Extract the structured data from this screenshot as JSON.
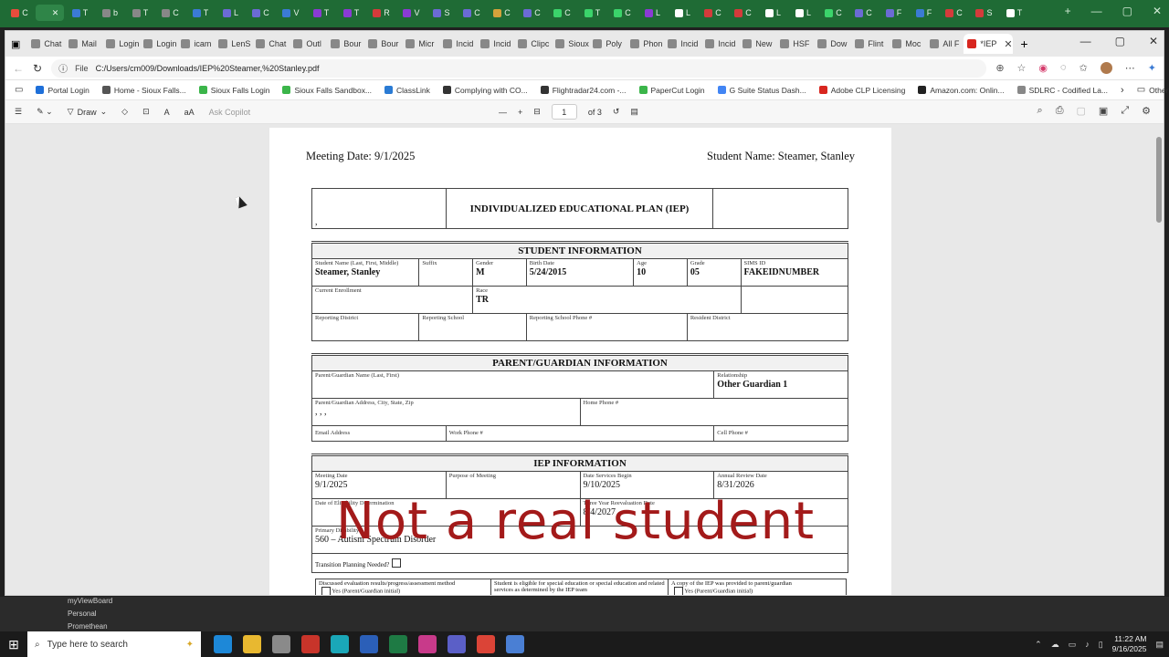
{
  "pinned_tabs": [
    {
      "label": "C",
      "color": "#e74c3c"
    },
    {
      "label": "✕",
      "color": "#2f8548"
    },
    {
      "label": "T",
      "color": "#3b7bd4"
    },
    {
      "label": "b",
      "color": "#888888"
    },
    {
      "label": "T",
      "color": "#888888"
    },
    {
      "label": "C",
      "color": "#888888"
    },
    {
      "label": "T",
      "color": "#3b7bd4"
    },
    {
      "label": "L",
      "color": "#6b6bd4"
    },
    {
      "label": "C",
      "color": "#6b6bd4"
    },
    {
      "label": "V",
      "color": "#3b7bd4"
    },
    {
      "label": "T",
      "color": "#8a3bd4"
    },
    {
      "label": "T",
      "color": "#8a3bd4"
    },
    {
      "label": "R",
      "color": "#d43b3b"
    },
    {
      "label": "V",
      "color": "#8a3bd4"
    },
    {
      "label": "S",
      "color": "#6b6bd4"
    },
    {
      "label": "C",
      "color": "#6b6bd4"
    },
    {
      "label": "C",
      "color": "#d4a23b"
    },
    {
      "label": "C",
      "color": "#6b6bd4"
    },
    {
      "label": "C",
      "color": "#3bd46b"
    },
    {
      "label": "T",
      "color": "#3bd46b"
    },
    {
      "label": "C",
      "color": "#3bd46b"
    },
    {
      "label": "L",
      "color": "#8a3bd4"
    },
    {
      "label": "L",
      "color": "#ffffff"
    },
    {
      "label": "C",
      "color": "#d43b3b"
    },
    {
      "label": "C",
      "color": "#d43b3b"
    },
    {
      "label": "L",
      "color": "#ffffff"
    },
    {
      "label": "L",
      "color": "#ffffff"
    },
    {
      "label": "C",
      "color": "#3bd46b"
    },
    {
      "label": "C",
      "color": "#6b6bd4"
    },
    {
      "label": "F",
      "color": "#6b6bd4"
    },
    {
      "label": "F",
      "color": "#3b7bd4"
    },
    {
      "label": "C",
      "color": "#d43b3b"
    },
    {
      "label": "S",
      "color": "#d43b3b"
    },
    {
      "label": "T",
      "color": "#ffffff"
    }
  ],
  "window_tabs": [
    {
      "label": "Chat"
    },
    {
      "label": "Mail"
    },
    {
      "label": "Login"
    },
    {
      "label": "Login"
    },
    {
      "label": "icam"
    },
    {
      "label": "LenS"
    },
    {
      "label": "Chat"
    },
    {
      "label": "Outl"
    },
    {
      "label": "Bour"
    },
    {
      "label": "Bour"
    },
    {
      "label": "Micr"
    },
    {
      "label": "Incid"
    },
    {
      "label": "Incid"
    },
    {
      "label": "Clipc"
    },
    {
      "label": "Sioux"
    },
    {
      "label": "Poly"
    },
    {
      "label": "Phon"
    },
    {
      "label": "Incid"
    },
    {
      "label": "Incid"
    },
    {
      "label": "New"
    },
    {
      "label": "HSF"
    },
    {
      "label": "Dow"
    },
    {
      "label": "Flint"
    },
    {
      "label": "Moc"
    },
    {
      "label": "All F"
    },
    {
      "label": "*IEP"
    }
  ],
  "window_controls": {
    "minimize": "—",
    "maximize": "▢",
    "close": "✕"
  },
  "address": {
    "file_tag": "File",
    "url": "C:/Users/cm009/Downloads/IEP%20Steamer,%20Stanley.pdf"
  },
  "favorites": [
    {
      "label": "Portal Login",
      "color": "#1e6fd9"
    },
    {
      "label": "Home - Sioux Falls...",
      "color": "#555555"
    },
    {
      "label": "Sioux Falls Login",
      "color": "#3bb54a"
    },
    {
      "label": "Sioux Falls Sandbox...",
      "color": "#3bb54a"
    },
    {
      "label": "ClassLink",
      "color": "#2a7bd4"
    },
    {
      "label": "Complying with CO...",
      "color": "#333333"
    },
    {
      "label": "Flightradar24.com -...",
      "color": "#333333"
    },
    {
      "label": "PaperCut Login",
      "color": "#3bb54a"
    },
    {
      "label": "G Suite Status Dash...",
      "color": "#4285f4"
    },
    {
      "label": "Adobe CLP Licensing",
      "color": "#d8261f"
    },
    {
      "label": "Amazon.com: Onlin...",
      "color": "#222222"
    },
    {
      "label": "SDLRC - Codified La...",
      "color": "#888888"
    }
  ],
  "other_favorites": "Other favorites",
  "pdf_toolbar": {
    "draw": "Draw",
    "copilot": "Ask Copilot",
    "page": "1",
    "of": "of 3"
  },
  "doc": {
    "meeting_date": "Meeting Date: 9/1/2025",
    "student_name": "Student Name: Steamer, Stanley",
    "title": "INDIVIDUALIZED EDUCATIONAL PLAN (IEP)",
    "title_left": ",",
    "student_info": {
      "heading": "STUDENT INFORMATION",
      "name_label": "Student Name (Last, First, Middle)",
      "name": "Steamer, Stanley",
      "suffix_label": "Suffix",
      "gender_label": "Gender",
      "gender": "M",
      "birth_label": "Birth Date",
      "birth": "5/24/2015",
      "age_label": "Age",
      "age": "10",
      "grade_label": "Grade",
      "grade": "05",
      "sims_label": "SIMS ID",
      "sims": "FAKEIDNUMBER",
      "enroll_label": "Current Enrollment",
      "race_label": "Race",
      "race": "TR",
      "district_label": "Reporting District",
      "school_label": "Reporting School",
      "phone_label": "Reporting School Phone #",
      "resident_label": "Resident District"
    },
    "guardian": {
      "heading": "PARENT/GUARDIAN INFORMATION",
      "name_label": "Parent/Guardian Name (Last, First)",
      "rel_label": "Relationship",
      "relationship": "Other Guardian 1",
      "addr_label": "Parent/Guardian Address, City, State, Zip",
      "address": ", , ,",
      "home_label": "Home Phone #",
      "email_label": "Email Address",
      "work_label": "Work Phone #",
      "cell_label": "Cell Phone #"
    },
    "iep": {
      "heading": "IEP INFORMATION",
      "meeting_label": "Meeting Date",
      "meeting": "9/1/2025",
      "purpose_label": "Purpose of Meeting",
      "begin_label": "Date Services Begin",
      "begin": "9/10/2025",
      "review_label": "Annual Review Date",
      "review": "8/31/2026",
      "elig_label": "Date of Eligibility Determination",
      "reeval_label": "Three Year Reevaluation Date",
      "reeval": "8/4/2027",
      "primary_label": "Primary Disability",
      "primary": "560 – Autism Spectrum Disorder",
      "transition_label": "Transition Planning Needed?",
      "col1": "Discussed evaluation results/progress/assessment method",
      "col2": "Student is eligible for special education or special education and related services as determined by the IEP team",
      "col3": "A copy of the IEP was provided to parent/guardian",
      "yes": "Yes",
      "initial": "(Parent/Guardian initial)"
    }
  },
  "watermark": "Not a real student",
  "underlying": {
    "item1": "myViewBoard",
    "item2": "Personal",
    "item3": "Promethean"
  },
  "taskbar": {
    "search_placeholder": "Type here to search",
    "time": "11:22 AM",
    "date": "9/16/2025"
  }
}
